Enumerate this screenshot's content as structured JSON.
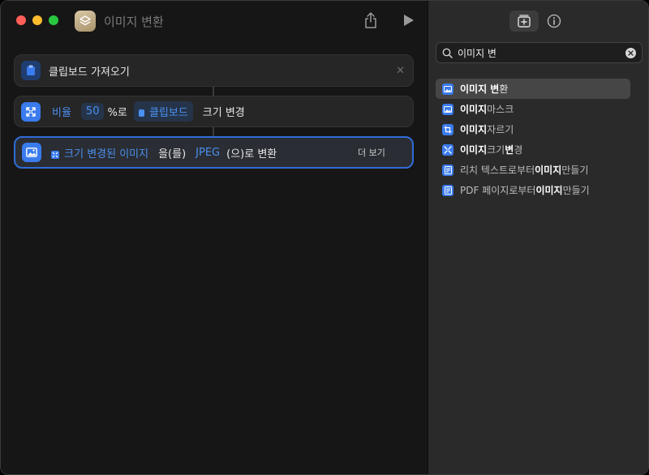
{
  "window": {
    "title": "이미지 변환"
  },
  "workflow": {
    "actions": [
      {
        "label": "클립보드 가져오기",
        "remove": "×"
      },
      {
        "parts": {
          "ratio_label": "비율",
          "value": "50",
          "unit": "%로",
          "source": "클립보드",
          "verb": "크기 변경"
        }
      },
      {
        "parts": {
          "input": "크기 변경된 이미지",
          "particle": "을(를)",
          "format": "JPEG",
          "suffix": "(으)로 변환",
          "more": "더 보기"
        }
      }
    ]
  },
  "search": {
    "value": "이미지 변",
    "placeholder": ""
  },
  "results": [
    {
      "pre": "",
      "hl": "이미지 변",
      "post": "환",
      "icon": "image-icon"
    },
    {
      "pre": "",
      "hl": "이미지",
      "post": " 마스크",
      "icon": "image-icon"
    },
    {
      "pre": "",
      "hl": "이미지",
      "post": " 자르기",
      "icon": "crop-icon"
    },
    {
      "pre": "",
      "hl": "이미지",
      "post": " 크기 ",
      "hl2": "변",
      "post2": "경",
      "icon": "resize-icon"
    },
    {
      "pre": "리치 텍스트로부터 ",
      "hl": "이미지",
      "post": " 만들기",
      "icon": "document-icon"
    },
    {
      "pre": "PDF 페이지로부터 ",
      "hl": "이미지",
      "post": " 만들기",
      "icon": "document-icon"
    }
  ],
  "colors": {
    "accent": "#3a7bed",
    "token_text": "#4a90f0",
    "selection_border": "#2f6cd8"
  }
}
